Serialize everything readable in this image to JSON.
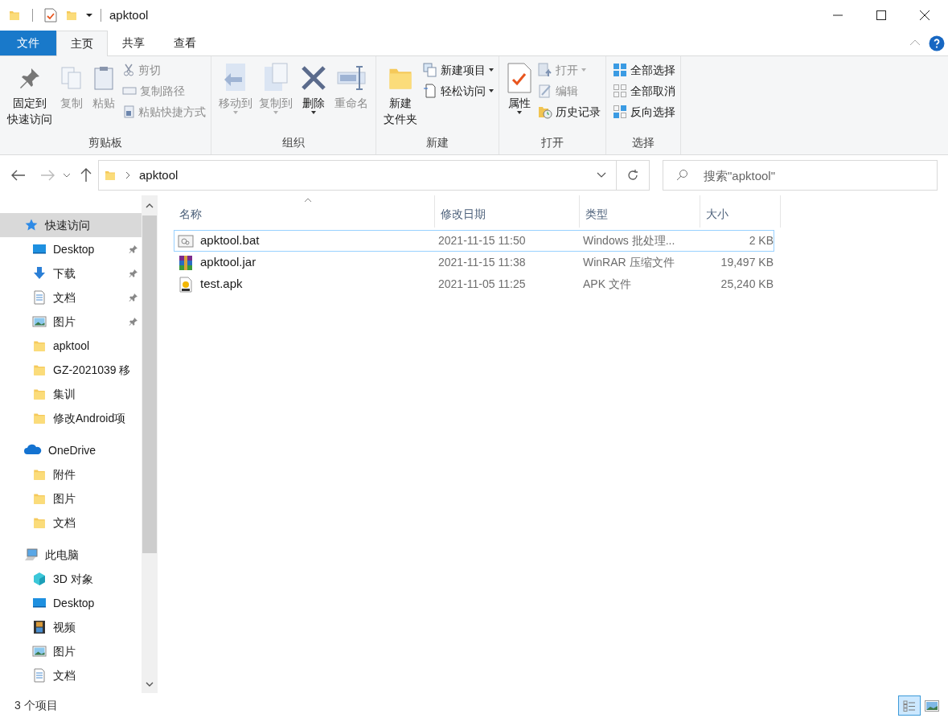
{
  "title_bar": {
    "title": "apktool"
  },
  "ribbon_tabs": [
    {
      "label": "文件",
      "kind": "file",
      "selected": false
    },
    {
      "label": "主页",
      "kind": "tab",
      "selected": true
    },
    {
      "label": "共享",
      "kind": "tab",
      "selected": false
    },
    {
      "label": "查看",
      "kind": "tab",
      "selected": false
    }
  ],
  "ribbon_groups": [
    {
      "label": "剪贴板",
      "items": [
        {
          "lines": [
            "固定到",
            "快速访问"
          ],
          "kind": "large",
          "disabled": false,
          "dropdown": false
        },
        {
          "label": "复制",
          "kind": "large",
          "disabled": true,
          "dropdown": false
        },
        {
          "label": "粘贴",
          "kind": "large",
          "disabled": true,
          "dropdown": false
        },
        {
          "label": "剪切",
          "kind": "small",
          "disabled": true,
          "dropdown": false
        },
        {
          "label": "复制路径",
          "kind": "small",
          "disabled": true,
          "dropdown": false
        },
        {
          "label": "粘贴快捷方式",
          "kind": "small",
          "disabled": true,
          "dropdown": false
        }
      ]
    },
    {
      "label": "组织",
      "items": [
        {
          "label": "移动到",
          "kind": "large",
          "disabled": true,
          "dropdown": true
        },
        {
          "label": "复制到",
          "kind": "large",
          "disabled": true,
          "dropdown": true
        },
        {
          "label": "删除",
          "kind": "large",
          "disabled": false,
          "dropdown": true
        },
        {
          "label": "重命名",
          "kind": "large",
          "disabled": true,
          "dropdown": false
        }
      ]
    },
    {
      "label": "新建",
      "items": [
        {
          "lines": [
            "新建",
            "文件夹"
          ],
          "kind": "large",
          "disabled": false,
          "dropdown": false
        },
        {
          "label": "新建项目",
          "kind": "small",
          "disabled": false,
          "dropdown": true
        },
        {
          "label": "轻松访问",
          "kind": "small",
          "disabled": false,
          "dropdown": true
        }
      ]
    },
    {
      "label": "打开",
      "items": [
        {
          "label": "属性",
          "kind": "large",
          "disabled": false,
          "dropdown": true
        },
        {
          "label": "打开",
          "kind": "small",
          "disabled": true,
          "dropdown": true
        },
        {
          "label": "编辑",
          "kind": "small",
          "disabled": true,
          "dropdown": false
        },
        {
          "label": "历史记录",
          "kind": "small",
          "disabled": false,
          "dropdown": false
        }
      ]
    },
    {
      "label": "选择",
      "items": [
        {
          "label": "全部选择",
          "kind": "small",
          "disabled": false,
          "dropdown": false
        },
        {
          "label": "全部取消",
          "kind": "small",
          "disabled": false,
          "dropdown": false
        },
        {
          "label": "反向选择",
          "kind": "small",
          "disabled": false,
          "dropdown": false
        }
      ]
    }
  ],
  "address_bar": {
    "path": [
      "apktool"
    ],
    "search": {
      "placeholder": "搜索\"apktool\""
    }
  },
  "sidebar": {
    "items": [
      {
        "label": "快速访问",
        "kind": "star",
        "selected": true,
        "children": [
          {
            "label": "Desktop",
            "kind": "desktop",
            "pinned": true,
            "selected": false
          },
          {
            "label": "下载",
            "kind": "download",
            "pinned": true,
            "selected": false
          },
          {
            "label": "文档",
            "kind": "documents",
            "pinned": true,
            "selected": false
          },
          {
            "label": "图片",
            "kind": "pictures",
            "pinned": true,
            "selected": false
          },
          {
            "label": "apktool",
            "kind": "folder",
            "pinned": false,
            "selected": false
          },
          {
            "label": "GZ-2021039 移",
            "kind": "folder",
            "pinned": false,
            "selected": false
          },
          {
            "label": "集训",
            "kind": "folder",
            "pinned": false,
            "selected": false
          },
          {
            "label": "修改Android项",
            "kind": "folder",
            "pinned": false,
            "selected": false
          }
        ]
      },
      {
        "label": "OneDrive",
        "kind": "onedrive",
        "selected": false,
        "children": [
          {
            "label": "附件",
            "kind": "folder",
            "pinned": false,
            "selected": false
          },
          {
            "label": "图片",
            "kind": "folder",
            "pinned": false,
            "selected": false
          },
          {
            "label": "文档",
            "kind": "folder",
            "pinned": false,
            "selected": false
          }
        ]
      },
      {
        "label": "此电脑",
        "kind": "pc",
        "selected": false,
        "children": [
          {
            "label": "3D 对象",
            "kind": "cube",
            "pinned": false,
            "selected": false
          },
          {
            "label": "Desktop",
            "kind": "desktop",
            "pinned": false,
            "selected": false
          },
          {
            "label": "视频",
            "kind": "videos",
            "pinned": false,
            "selected": false
          },
          {
            "label": "图片",
            "kind": "pictures",
            "pinned": false,
            "selected": false
          },
          {
            "label": "文档",
            "kind": "documents",
            "pinned": false,
            "selected": false
          }
        ]
      }
    ]
  },
  "file_list": {
    "columns": [
      {
        "label": "名称",
        "sorted": true
      },
      {
        "label": "修改日期",
        "sorted": false
      },
      {
        "label": "类型",
        "sorted": false
      },
      {
        "label": "大小",
        "sorted": false
      }
    ],
    "rows": [
      {
        "kind": "bat",
        "name": "apktool.bat",
        "modified": "2021-11-15 11:50",
        "type": "Windows 批处理...",
        "size": "2 KB",
        "focused": true
      },
      {
        "kind": "jar",
        "name": "apktool.jar",
        "modified": "2021-11-15 11:38",
        "type": "WinRAR 压缩文件",
        "size": "19,497 KB",
        "focused": false
      },
      {
        "kind": "apk",
        "name": "test.apk",
        "modified": "2021-11-05 11:25",
        "type": "APK 文件",
        "size": "25,240 KB",
        "focused": false
      }
    ]
  },
  "status_bar": {
    "text": "3 个项目",
    "views": [
      {
        "kind": "details",
        "selected": true
      },
      {
        "kind": "large-icons",
        "selected": false
      }
    ]
  }
}
